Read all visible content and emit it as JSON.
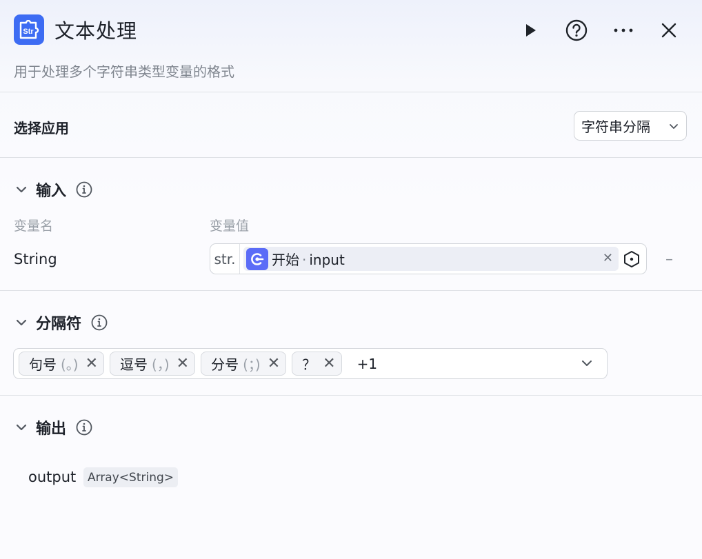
{
  "header": {
    "app_icon_text": "Str",
    "title": "文本处理",
    "subtitle": "用于处理多个字符串类型变量的格式",
    "actions": [
      "play-icon",
      "help-icon",
      "more-icon",
      "close-icon"
    ]
  },
  "select_app": {
    "label": "选择应用",
    "value": "字符串分隔"
  },
  "input_section": {
    "title": "输入",
    "col_name": "变量名",
    "col_value": "变量值",
    "rows": [
      {
        "name": "String",
        "type_tag": "str.",
        "ref_node": "开始",
        "ref_sep": "·",
        "ref_var": "input",
        "remove": "–"
      }
    ]
  },
  "separator_section": {
    "title": "分隔符",
    "tags": [
      {
        "label": "句号",
        "symbol": "(。)"
      },
      {
        "label": "逗号",
        "symbol": "(，)"
      },
      {
        "label": "分号",
        "symbol": "(；)"
      },
      {
        "label": "？",
        "symbol": ""
      }
    ],
    "more": "+1"
  },
  "output_section": {
    "title": "输出",
    "name": "output",
    "type": "Array<String>"
  },
  "colors": {
    "accent": "#3d6cf3",
    "ref_icon": "#5b6cf7"
  }
}
